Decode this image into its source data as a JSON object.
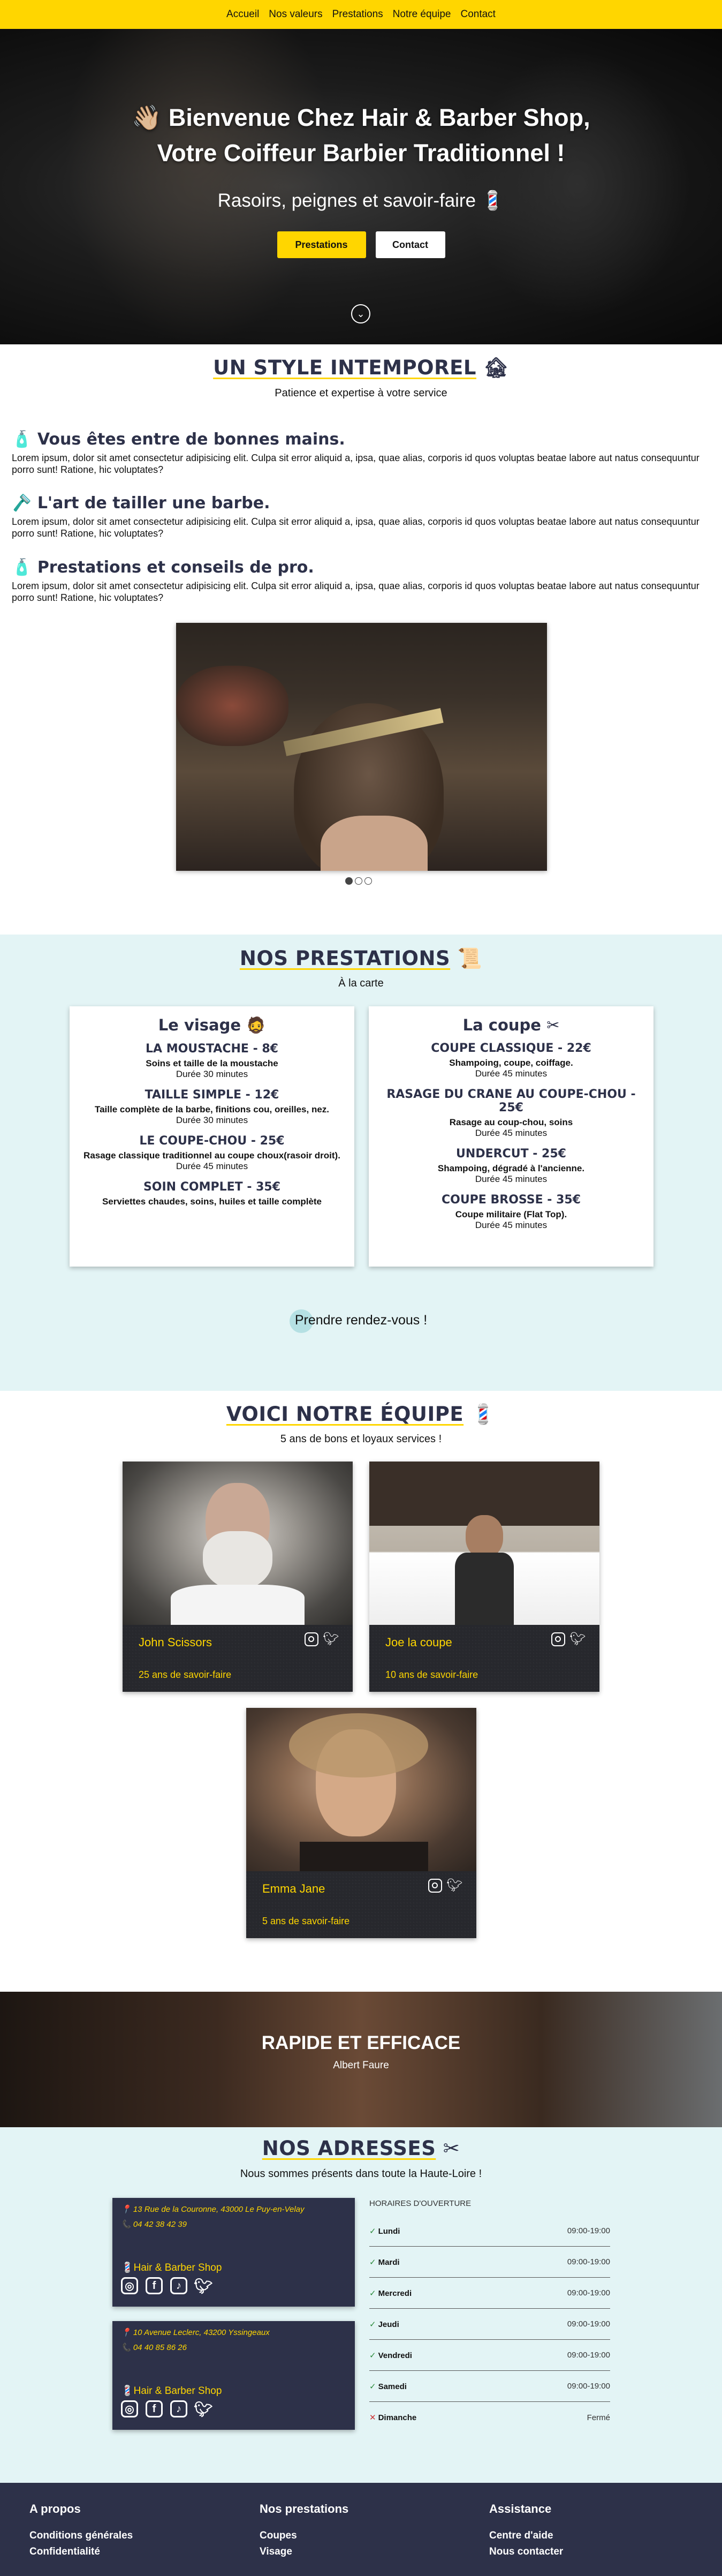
{
  "nav": [
    "Accueil",
    "Nos valeurs",
    "Prestations",
    "Notre équipe",
    "Contact"
  ],
  "hero": {
    "title_line1": "👋🏼 Bienvenue Chez Hair & Barber Shop,",
    "title_line2": "Votre Coiffeur Barbier Traditionnel !",
    "subtitle": "Rasoirs, peignes et savoir-faire 💈",
    "btn_primary": "Prestations",
    "btn_secondary": "Contact",
    "down_icon": "⌄"
  },
  "style_section": {
    "title": "UN STYLE INTEMPOREL",
    "title_icon": "🏚",
    "subtitle": "Patience et expertise à votre service",
    "features": [
      {
        "icon": "🧴",
        "title": "Vous êtes entre de bonnes mains.",
        "text": "Lorem ipsum, dolor sit amet consectetur adipisicing elit. Culpa sit error aliquid a, ipsa, quae alias, corporis id quos voluptas beatae labore aut natus consequuntur porro sunt! Ratione, hic voluptates?"
      },
      {
        "icon": "🪒",
        "title": "L'art de tailler une barbe.",
        "text": "Lorem ipsum, dolor sit amet consectetur adipisicing elit. Culpa sit error aliquid a, ipsa, quae alias, corporis id quos voluptas beatae labore aut natus consequuntur porro sunt! Ratione, hic voluptates?"
      },
      {
        "icon": "🧴",
        "title": "Prestations et conseils de pro.",
        "text": "Lorem ipsum, dolor sit amet consectetur adipisicing elit. Culpa sit error aliquid a, ipsa, quae alias, corporis id quos voluptas beatae labore aut natus consequuntur porro sunt! Ratione, hic voluptates?"
      }
    ]
  },
  "prestations": {
    "title": "NOS PRESTATIONS",
    "title_icon": "📜",
    "subtitle": "À la carte",
    "visage": {
      "title": "Le visage",
      "icon": "🧔",
      "items": [
        {
          "t": "LA MOUSTACHE - 8€",
          "d": "Soins et taille de la moustache",
          "m": "Durée 30 minutes"
        },
        {
          "t": "TAILLE SIMPLE - 12€",
          "d": "Taille complète de la barbe, finitions cou, oreilles, nez.",
          "m": "Durée 30 minutes"
        },
        {
          "t": "LE COUPE-CHOU - 25€",
          "d": "Rasage classique traditionnel au coupe choux(rasoir droit).",
          "m": "Durée 45 minutes"
        },
        {
          "t": "SOIN COMPLET - 35€",
          "d": "Serviettes chaudes, soins, huiles et taille complète",
          "m": ""
        }
      ]
    },
    "coupe": {
      "title": "La coupe",
      "icon": "✂",
      "items": [
        {
          "t": "COUPE CLASSIQUE - 22€",
          "d": "Shampoing, coupe, coiffage.",
          "m": "Durée 45 minutes"
        },
        {
          "t": "RASAGE DU CRANE AU COUPE-CHOU - 25€",
          "d": "Rasage au coup-chou, soins",
          "m": "Durée 45 minutes"
        },
        {
          "t": "UNDERCUT - 25€",
          "d": "Shampoing, dégradé à l'ancienne.",
          "m": "Durée 45 minutes"
        },
        {
          "t": "COUPE BROSSE - 35€",
          "d": "Coupe militaire (Flat Top).",
          "m": "Durée 45 minutes"
        }
      ]
    },
    "rdv": "Prendre rendez-vous !"
  },
  "team": {
    "title": "VOICI NOTRE ÉQUIPE",
    "title_icon": "💈",
    "subtitle": "5 ans de bons et loyaux services !",
    "members": [
      {
        "name": "John Scissors",
        "exp": "25 ans de savoir-faire"
      },
      {
        "name": "Joe la coupe",
        "exp": "10 ans de savoir-faire"
      },
      {
        "name": "Emma Jane",
        "exp": "5 ans de savoir-faire"
      }
    ]
  },
  "quote": {
    "title": "RAPIDE ET EFFICACE",
    "author": "Albert Faure"
  },
  "addresses": {
    "title": "NOS ADRESSES",
    "title_icon": "✂",
    "subtitle": "Nous sommes présents dans toute la Haute-Loire !",
    "shops": [
      {
        "address": "📍 13 Rue de la Couronne, 43000 Le Puy-en-Velay",
        "phone": "📞 04 42 38 42 39",
        "name": "💈Hair & Barber Shop"
      },
      {
        "address": "📍 10 Avenue Leclerc, 43200 Yssingeaux",
        "phone": "📞 04 40 85 86 26",
        "name": "💈Hair & Barber Shop"
      }
    ],
    "hours_title": "HORAIRES D'OUVERTURE",
    "hours": [
      {
        "mark": "✓",
        "day": "Lundi",
        "time": "09:00-19:00",
        "open": true
      },
      {
        "mark": "✓",
        "day": "Mardi",
        "time": "09:00-19:00",
        "open": true
      },
      {
        "mark": "✓",
        "day": "Mercredi",
        "time": "09:00-19:00",
        "open": true
      },
      {
        "mark": "✓",
        "day": "Jeudi",
        "time": "09:00-19:00",
        "open": true
      },
      {
        "mark": "✓",
        "day": "Vendredi",
        "time": "09:00-19:00",
        "open": true
      },
      {
        "mark": "✓",
        "day": "Samedi",
        "time": "09:00-19:00",
        "open": true
      },
      {
        "mark": "✕",
        "day": "Dimanche",
        "time": "Fermé",
        "open": false
      }
    ]
  },
  "footer": {
    "col1": {
      "title": "A propos",
      "links": [
        "Conditions générales",
        "Confidentialité"
      ]
    },
    "col2": {
      "title": "Nos prestations",
      "links": [
        "Coupes",
        "Visage"
      ]
    },
    "col3": {
      "title": "Assistance",
      "links": [
        "Centre d'aide",
        "Nous contacter"
      ]
    }
  },
  "colors": {
    "accent": "#ffd600",
    "navy": "#2d3149",
    "mint": "#e3f4f5"
  }
}
